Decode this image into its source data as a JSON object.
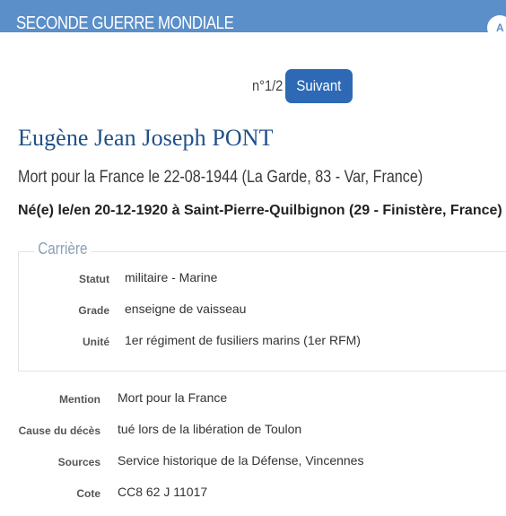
{
  "header": {
    "band_title": "SECONDE GUERRE MONDIALE",
    "badge_letter": "A"
  },
  "pager": {
    "count": "n°1/2",
    "next_label": "Suivant"
  },
  "person": {
    "name": "Eugène Jean Joseph PONT",
    "death": "Mort pour la France le 22-08-1944 (La Garde, 83 - Var, France)",
    "birth": "Né(e) le/en 20-12-1920 à Saint-Pierre-Quilbignon (29 - Finistère, France)"
  },
  "career": {
    "legend": "Carrière",
    "rows": [
      {
        "label": "Statut",
        "value": "militaire - Marine"
      },
      {
        "label": "Grade",
        "value": "enseigne de vaisseau"
      },
      {
        "label": "Unité",
        "value": "1er régiment de fusiliers marins (1er RFM)"
      }
    ]
  },
  "details": {
    "rows": [
      {
        "label": "Mention",
        "value": "Mort pour la France"
      },
      {
        "label": "Cause du décès",
        "value": "tué lors de la libération de Toulon"
      },
      {
        "label": "Sources",
        "value": "Service historique de la Défense, Vincennes"
      },
      {
        "label": "Cote",
        "value": "CC8 62 J 11017"
      }
    ]
  }
}
